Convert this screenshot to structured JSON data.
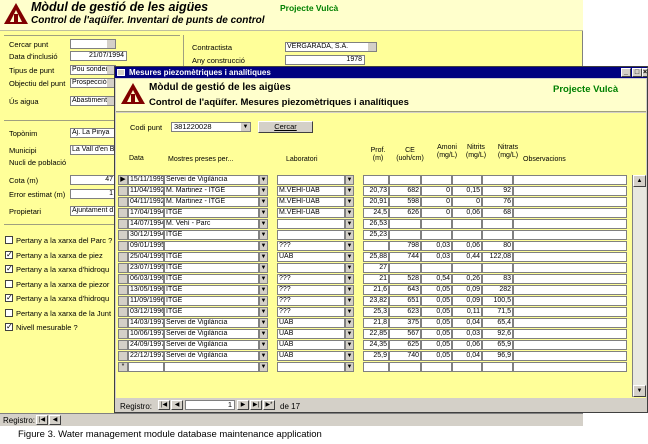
{
  "bg": {
    "title": "Mòdul de gestió de les aigües",
    "subtitle": "Control de l'aqüífer. Inventari de punts de control",
    "project": "Projecte Vulcà",
    "left_labels": [
      "Cercar punt",
      "Data d'inclusió",
      "Tipus de punt",
      "Objectiu del punt",
      "Ús aigua"
    ],
    "left_values": [
      "",
      "21/07/1994",
      "Pou sondeig",
      "Prospecció d",
      "Abastiment"
    ],
    "right_labels": [
      "Contractista",
      "Any construcció"
    ],
    "right_values": [
      "VERGARADA, S.A.",
      "1978"
    ],
    "loc_labels": [
      "Topònim",
      "Municipi",
      "Nucli de població",
      "Cota (m)",
      "Error estimat (m)",
      "Propietari"
    ],
    "loc_values": [
      "Aj. La Pinya",
      "La Vall d'en B",
      "",
      "47",
      "1",
      "Ajuntament d"
    ],
    "checks": [
      {
        "label": "Pertany a la xarxa del Parc ?",
        "on": false
      },
      {
        "label": "Pertany a la xarxa de piez",
        "on": true
      },
      {
        "label": "Pertany a la xarxa d'hidroqu",
        "on": true
      },
      {
        "label": "Pertany a la xarxa de piezor",
        "on": false
      },
      {
        "label": "Pertany a la xarxa d'hidroqu",
        "on": true
      },
      {
        "label": "Pertany a la xarxa de la Junt",
        "on": false
      },
      {
        "label": "Nivell mesurable ?",
        "on": true
      }
    ],
    "registro": "Registro:"
  },
  "fw": {
    "window_title": "Mesures piezomètriques i analítiques",
    "title": "Mòdul de gestió de les aigües",
    "subtitle": "Control de l'aqüífer. Mesures piezomètriques i analítiques",
    "project": "Projecte Vulcà",
    "codi_label": "Codi punt",
    "codi_value": "381220028",
    "search": "Cercar",
    "headers": {
      "data": "Data",
      "mostres": "Mostres preses per...",
      "lab": "Laboratori",
      "prof": "Prof. (m)",
      "ce": "CE (uoh/cm)",
      "amoni": "Amoni (mg/L)",
      "nitrits": "Nitrits (mg/L)",
      "nitrats": "Nitrats (mg/L)",
      "obs": "Observacions"
    },
    "rows": [
      [
        "15/11/1999",
        "Servei de Vigilància",
        "",
        "",
        "",
        "",
        "",
        ""
      ],
      [
        "11/04/1992",
        "M. Martinez - ITGE",
        "M.VEHI-UAB",
        "20,73",
        "682",
        "0",
        "0,15",
        "92"
      ],
      [
        "04/11/1992",
        "M. Martinez - ITGE",
        "M.VEHI-UAB",
        "20,91",
        "598",
        "0",
        "0",
        "76"
      ],
      [
        "17/04/1994",
        "ITGE",
        "M.VEHI-UAB",
        "24,5",
        "626",
        "0",
        "0,06",
        "68"
      ],
      [
        "14/07/1994",
        "M. Vehí - Parc",
        "",
        "26,53",
        "",
        "",
        "",
        ""
      ],
      [
        "30/12/1994",
        "ITGE",
        "",
        "25,23",
        "",
        "",
        "",
        ""
      ],
      [
        "09/01/1995",
        "",
        "???",
        "",
        "798",
        "0,03",
        "0,06",
        "80"
      ],
      [
        "25/04/1995",
        "ITGE",
        "UAB",
        "25,88",
        "744",
        "0,03",
        "0,44",
        "122,08"
      ],
      [
        "23/07/1995",
        "ITGE",
        "",
        "27",
        "",
        "",
        "",
        ""
      ],
      [
        "06/03/1996",
        "ITGE",
        "???",
        "21",
        "528",
        "0,54",
        "0,26",
        "83"
      ],
      [
        "13/05/1996",
        "ITGE",
        "???",
        "21,6",
        "643",
        "0,05",
        "0,09",
        "282"
      ],
      [
        "11/09/1996",
        "ITGE",
        "???",
        "23,82",
        "651",
        "0,05",
        "0,09",
        "100,5"
      ],
      [
        "03/12/1996",
        "ITGE",
        "???",
        "25,3",
        "623",
        "0,05",
        "0,11",
        "71,5"
      ],
      [
        "14/03/1997",
        "Servei de Vigilància",
        "UAB",
        "21,8",
        "375",
        "0,05",
        "0,04",
        "65,4"
      ],
      [
        "10/06/1997",
        "Servei de Vigilància",
        "UAB",
        "22,85",
        "567",
        "0,05",
        "0,03",
        "92,6"
      ],
      [
        "24/09/1997",
        "Servei de Vigilància",
        "UAB",
        "24,35",
        "625",
        "0,05",
        "0,06",
        "65,9"
      ],
      [
        "22/12/1997",
        "Servei de Vigilància",
        "UAB",
        "25,9",
        "740",
        "0,05",
        "0,04",
        "96,9"
      ]
    ],
    "registro": "Registro:",
    "record": "1",
    "of": "de 17"
  },
  "caption": "Figure 3. Water management module database maintenance application"
}
